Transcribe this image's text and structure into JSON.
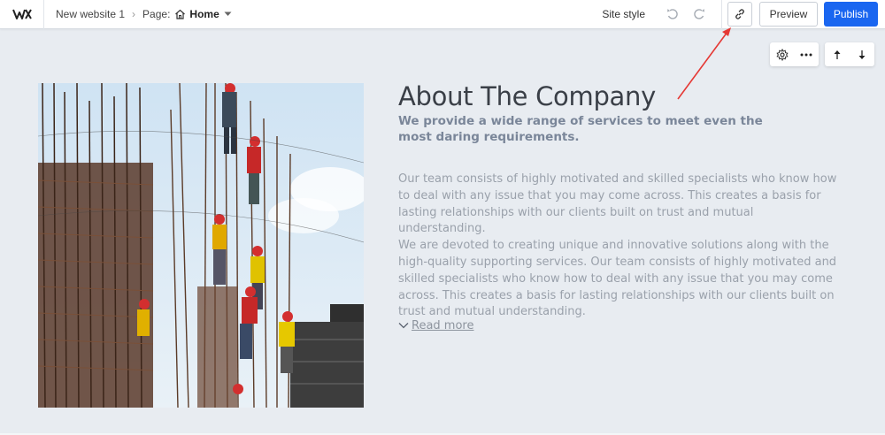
{
  "header": {
    "site_name": "New website 1",
    "breadcrumb_sep": "›",
    "page_label": "Page:",
    "page_name": "Home",
    "site_style": "Site style",
    "preview_label": "Preview",
    "publish_label": "Publish"
  },
  "icons": {
    "logo": "wix-logo-icon",
    "home": "home-icon",
    "caret": "caret-down-icon",
    "undo": "undo-icon",
    "redo": "redo-icon",
    "link": "link-icon",
    "settings": "settings-gear-icon",
    "more": "more-dots-icon",
    "move_up": "arrow-up-icon",
    "move_down": "arrow-down-icon",
    "read_more": "chevron-down-icon"
  },
  "colors": {
    "publish": "#1a66f0",
    "canvas_bg": "#e8ecf1",
    "annotation_arrow": "#e53935"
  },
  "section": {
    "title": "About The Company",
    "subtitle": "We provide a wide range of services to meet even the most daring requirements.",
    "body_p1": "Our team consists of highly motivated and skilled specialists who know how to deal with any issue that you may come across. This creates a basis for lasting relationships with our clients built on trust and mutual understanding.",
    "body_p2": "We are devoted to creating unique and innovative solutions along with the high-quality supporting services. Our team consists of highly motivated and skilled specialists who know how to deal with any issue that you may come across. This creates a basis for lasting relationships with our clients built on trust and mutual understanding.",
    "read_more": "Read more"
  }
}
